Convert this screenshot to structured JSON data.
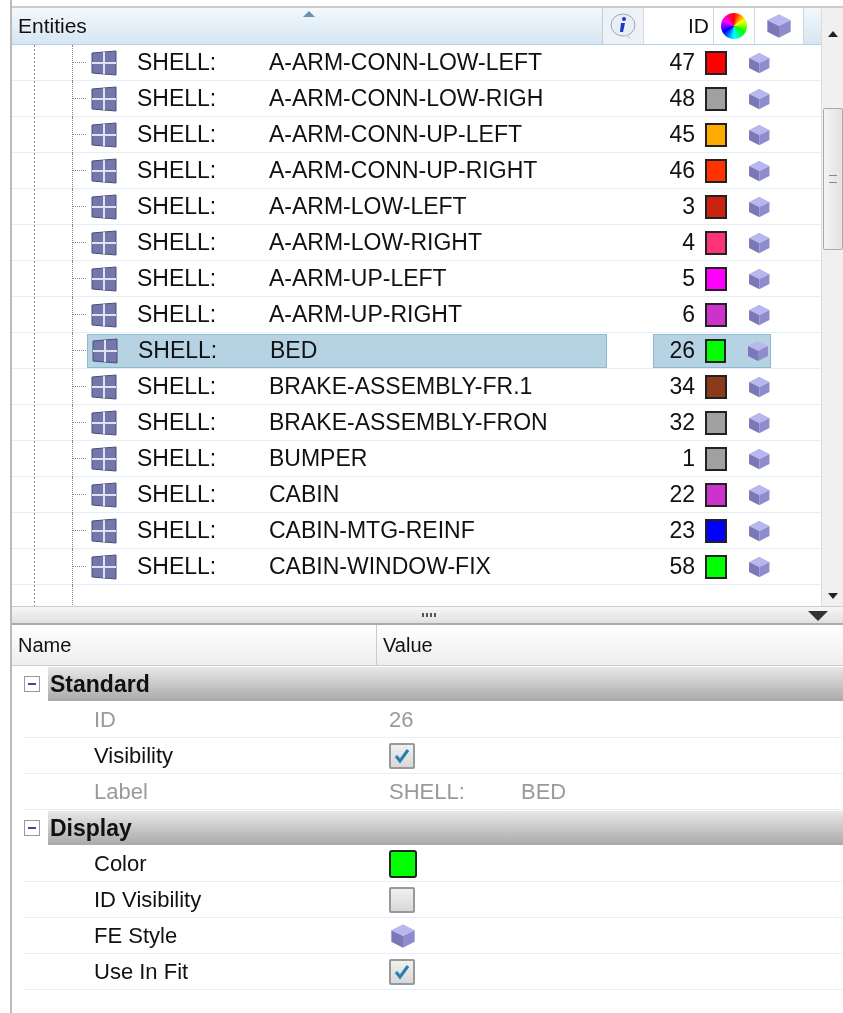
{
  "tree": {
    "header": {
      "title": "Entities",
      "id": "ID"
    },
    "rows": [
      {
        "type": "SHELL:",
        "name": "A-ARM-CONN-LOW-LEFT",
        "id": "47",
        "color": "#ff0000",
        "selected": false
      },
      {
        "type": "SHELL:",
        "name": "A-ARM-CONN-LOW-RIGH",
        "id": "48",
        "color": "#a0a0a0",
        "selected": false
      },
      {
        "type": "SHELL:",
        "name": "A-ARM-CONN-UP-LEFT",
        "id": "45",
        "color": "#ffaa00",
        "selected": false
      },
      {
        "type": "SHELL:",
        "name": "A-ARM-CONN-UP-RIGHT",
        "id": "46",
        "color": "#ff3300",
        "selected": false
      },
      {
        "type": "SHELL:",
        "name": "A-ARM-LOW-LEFT",
        "id": "3",
        "color": "#cc2211",
        "selected": false
      },
      {
        "type": "SHELL:",
        "name": "A-ARM-LOW-RIGHT",
        "id": "4",
        "color": "#ff3377",
        "selected": false
      },
      {
        "type": "SHELL:",
        "name": "A-ARM-UP-LEFT",
        "id": "5",
        "color": "#ff00ff",
        "selected": false
      },
      {
        "type": "SHELL:",
        "name": "A-ARM-UP-RIGHT",
        "id": "6",
        "color": "#cc33cc",
        "selected": false
      },
      {
        "type": "SHELL:",
        "name": "BED",
        "id": "26",
        "color": "#00ff00",
        "selected": true
      },
      {
        "type": "SHELL:",
        "name": "BRAKE-ASSEMBLY-FR.1",
        "id": "34",
        "color": "#8b3a1a",
        "selected": false
      },
      {
        "type": "SHELL:",
        "name": "BRAKE-ASSEMBLY-FRON",
        "id": "32",
        "color": "#a0a0a0",
        "selected": false
      },
      {
        "type": "SHELL:",
        "name": "BUMPER",
        "id": "1",
        "color": "#a0a0a0",
        "selected": false
      },
      {
        "type": "SHELL:",
        "name": "CABIN",
        "id": "22",
        "color": "#cc33cc",
        "selected": false
      },
      {
        "type": "SHELL:",
        "name": "CABIN-MTG-REINF",
        "id": "23",
        "color": "#0000ff",
        "selected": false
      },
      {
        "type": "SHELL:",
        "name": "CABIN-WINDOW-FIX",
        "id": "58",
        "color": "#00ff00",
        "selected": false
      }
    ]
  },
  "properties": {
    "columns": [
      "Name",
      "Value"
    ],
    "groups": [
      {
        "title": "Standard",
        "expanded": true,
        "items": [
          {
            "name": "ID",
            "kind": "text",
            "value": "26",
            "disabled": true
          },
          {
            "name": "Visibility",
            "kind": "checkbox",
            "checked": true,
            "disabled": false
          },
          {
            "name": "Label",
            "kind": "label",
            "parts": [
              "SHELL:",
              "BED"
            ],
            "disabled": true
          }
        ]
      },
      {
        "title": "Display",
        "expanded": true,
        "items": [
          {
            "name": "Color",
            "kind": "color",
            "color": "#00ff00",
            "disabled": false
          },
          {
            "name": "ID Visibility",
            "kind": "checkbox",
            "checked": false,
            "disabled": false
          },
          {
            "name": "FE Style",
            "kind": "cube",
            "disabled": false
          },
          {
            "name": "Use In Fit",
            "kind": "checkbox",
            "checked": true,
            "disabled": false
          }
        ]
      }
    ]
  }
}
